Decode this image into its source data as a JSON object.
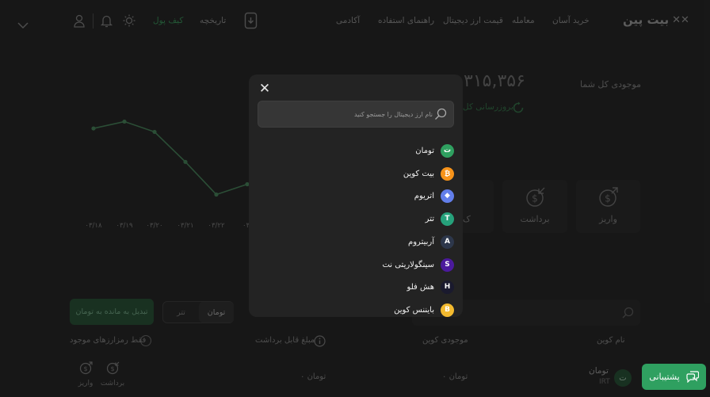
{
  "header": {
    "logo": "بیت پین",
    "nav": [
      "خرید آسان",
      "معامله",
      "قیمت ارز دیجیتال",
      "راهنمای استفاده",
      "آکادمی"
    ],
    "wallet_tab": "کیف پول",
    "history_tab": "تاریخچه"
  },
  "balance": {
    "label": "موجودی کل شما",
    "value": "۳۱۵,۳۵۶",
    "refresh": "بروزرسانی کل"
  },
  "chart_data": {
    "type": "line",
    "categories": [
      "۰۳/۱۸",
      "۰۳/۱۹",
      "۰۳/۲۰",
      "۰۳/۲۱",
      "۰۳/۲۲",
      "۰۳/"
    ],
    "values": [
      6.5,
      7.3,
      6.1,
      2.6,
      -1.2,
      0
    ],
    "ylim": [
      -3,
      9
    ],
    "grid": false,
    "color": "#4f8f63"
  },
  "actions": {
    "deposit": "واریز",
    "withdraw": "برداشت",
    "partial": "ک"
  },
  "assets": {
    "tab_toman": "تومان",
    "tab_tether": "تتر",
    "convert_btn": "تبدیل به مانده به تومان",
    "only_available": "فقط رمزارزهای موجود",
    "col_name": "نام کوین",
    "col_balance": "موجودی کوین",
    "col_withdrawable": "مبلغ قابل برداشت",
    "row_name": "تومان",
    "row_symbol": "IRT",
    "row_balance": "۰ تومان",
    "row_withdrawable": "۰ تومان",
    "row_withdraw": "برداشت",
    "row_deposit": "واریز"
  },
  "modal": {
    "search_placeholder": "نام ارز دیجیتال را جستجو کنید",
    "coins": [
      {
        "name": "تومان",
        "color": "#2fa060",
        "glyph": "ت"
      },
      {
        "name": "بیت کوین",
        "color": "#f7931a",
        "glyph": "₿"
      },
      {
        "name": "اتریوم",
        "color": "#627eea",
        "glyph": "◆"
      },
      {
        "name": "تتر",
        "color": "#26a17b",
        "glyph": "T"
      },
      {
        "name": "آربیتروم",
        "color": "#2d374b",
        "glyph": "A"
      },
      {
        "name": "سینگولاریتی نت",
        "color": "#4b1a9c",
        "glyph": "S"
      },
      {
        "name": "هش فلو",
        "color": "#1a1a2e",
        "glyph": "H"
      },
      {
        "name": "بایننس کوین",
        "color": "#f3ba2f",
        "glyph": "B"
      }
    ]
  },
  "support": "پشتیبانی",
  "colors": {
    "accent": "#2fa060",
    "modal_bg": "#232323",
    "page_bg": "#2b2b2b"
  }
}
